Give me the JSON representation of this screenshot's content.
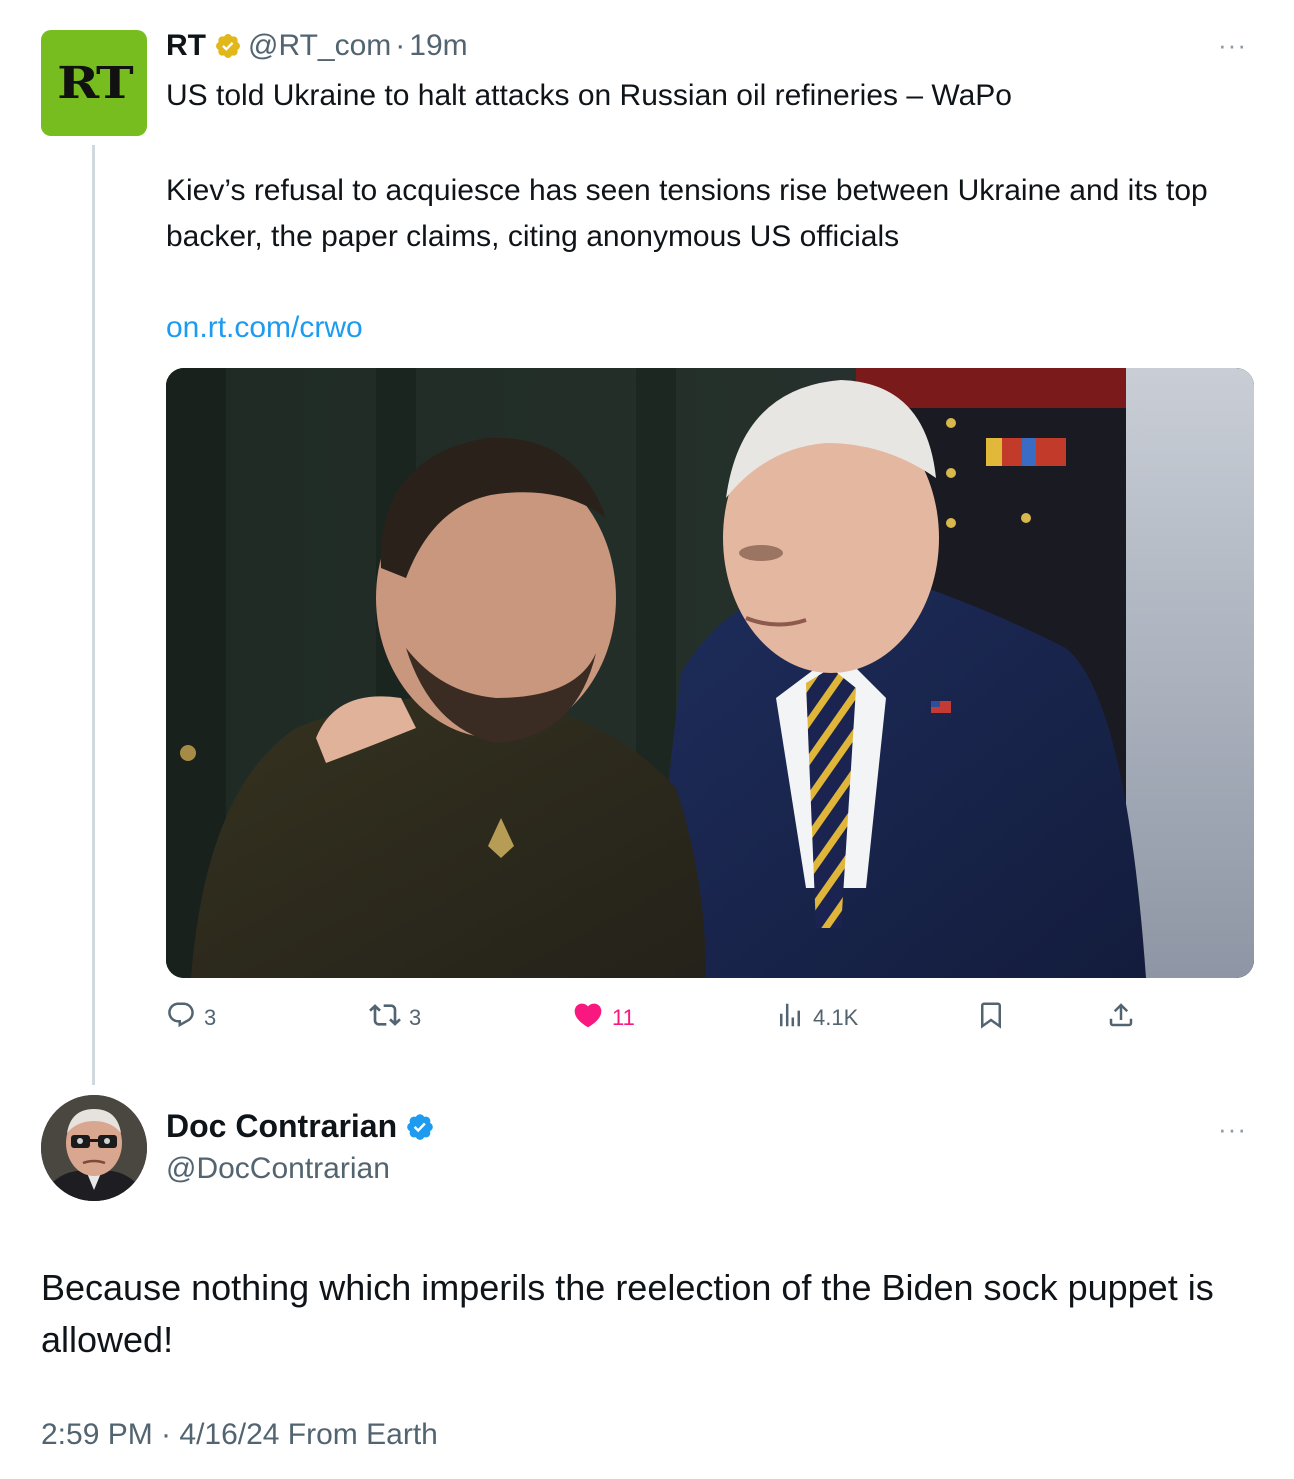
{
  "quoted_tweet": {
    "avatar_text": "RT",
    "author_name": "RT",
    "author_handle": "@RT_com",
    "separator": "·",
    "time_ago": "19m",
    "title_line": "US told Ukraine to halt attacks on Russian oil refineries – WaPo",
    "body": "Kiev’s refusal to acquiesce has seen tensions rise between Ukraine and its top backer, the paper claims, citing anonymous US officials",
    "link_text": "on.rt.com/crwo",
    "metrics": {
      "replies": "3",
      "reposts": "3",
      "likes": "11",
      "views": "4.1K"
    },
    "more_label": "···",
    "badge_color": "#e2b719",
    "avatar_color": "#77bd1f",
    "liked_color": "#f91880"
  },
  "main_tweet": {
    "author_name": "Doc Contrarian",
    "author_handle": "@DocContrarian",
    "text": "Because nothing which imperils the reelection of the Biden sock puppet is allowed!",
    "timestamp": "2:59 PM · 4/16/24 From Earth",
    "more_label": "···",
    "badge_color": "#1d9bf0"
  },
  "colors": {
    "text_primary": "#0f1419",
    "text_secondary": "#536471",
    "link": "#1d9bf0",
    "thread_line": "#cfd9de"
  }
}
